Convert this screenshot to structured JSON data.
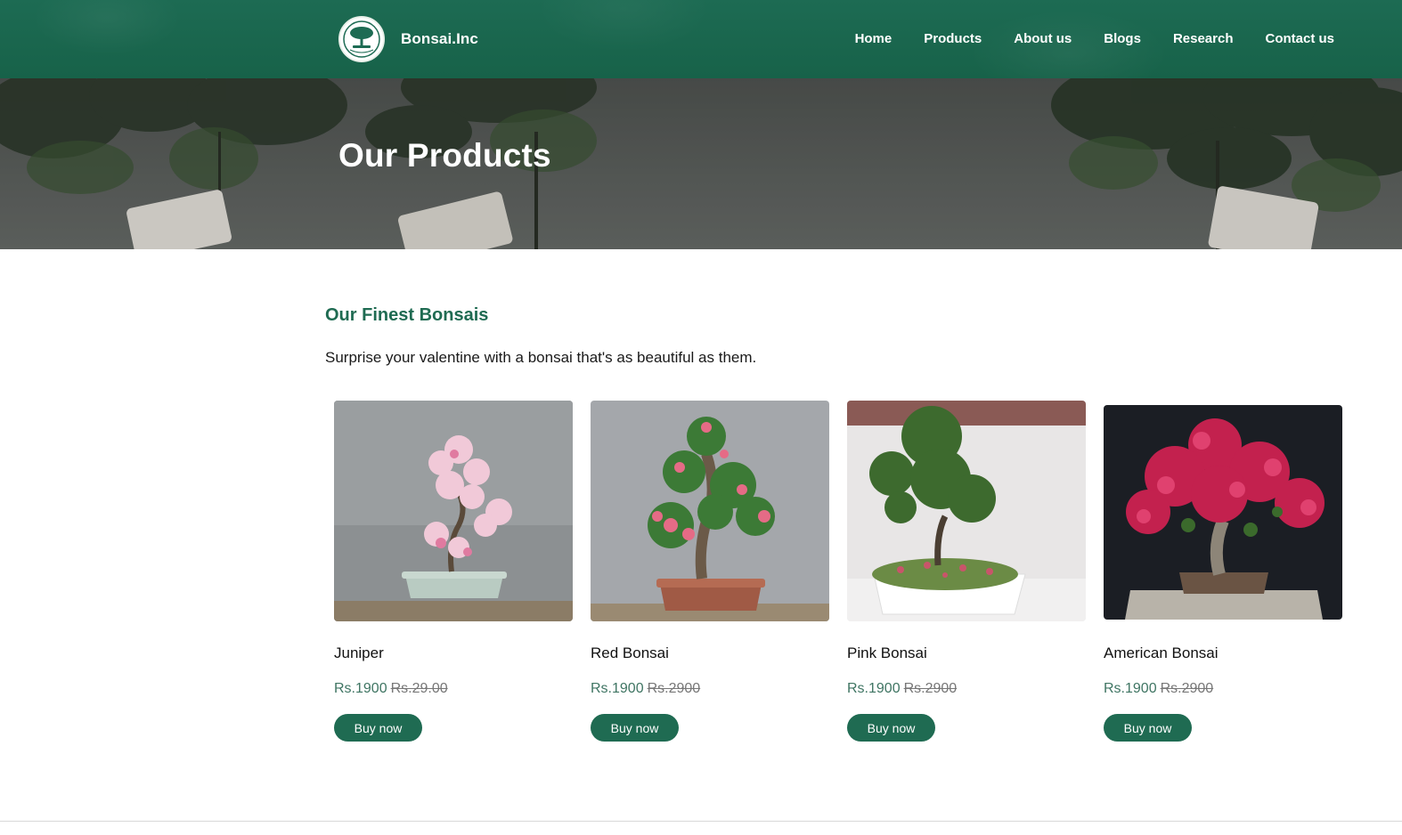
{
  "header": {
    "brand": "Bonsai.Inc",
    "nav": [
      "Home",
      "Products",
      "About us",
      "Blogs",
      "Research",
      "Contact us"
    ]
  },
  "hero": {
    "title": "Our Products"
  },
  "section": {
    "title": "Our Finest Bonsais",
    "subtitle": "Surprise your valentine with a bonsai that's as beautiful as them."
  },
  "products": [
    {
      "name": "Juniper",
      "price": "Rs.1900",
      "old_price": "Rs.29.00",
      "button": "Buy now"
    },
    {
      "name": "Red Bonsai",
      "price": "Rs.1900",
      "old_price": "Rs.2900",
      "button": "Buy now"
    },
    {
      "name": "Pink Bonsai",
      "price": "Rs.1900",
      "old_price": "Rs.2900",
      "button": "Buy now"
    },
    {
      "name": "American Bonsai",
      "price": "Rs.1900",
      "old_price": "Rs.2900",
      "button": "Buy now"
    }
  ],
  "colors": {
    "primary": "#1f6b52",
    "header": "#176249",
    "price": "#3f7563"
  }
}
